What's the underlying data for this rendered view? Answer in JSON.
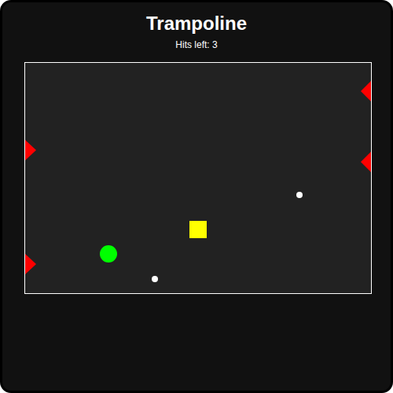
{
  "title": "Trampoline",
  "hud": {
    "hits_left": "Hits left: 3"
  },
  "arena": {
    "objects": [
      {
        "kind": "spike",
        "side": "right"
      },
      {
        "kind": "spike",
        "side": "right"
      },
      {
        "kind": "spike",
        "side": "left"
      },
      {
        "kind": "spike",
        "side": "left"
      },
      {
        "kind": "player"
      },
      {
        "kind": "block"
      },
      {
        "kind": "ball"
      },
      {
        "kind": "ball"
      }
    ]
  }
}
